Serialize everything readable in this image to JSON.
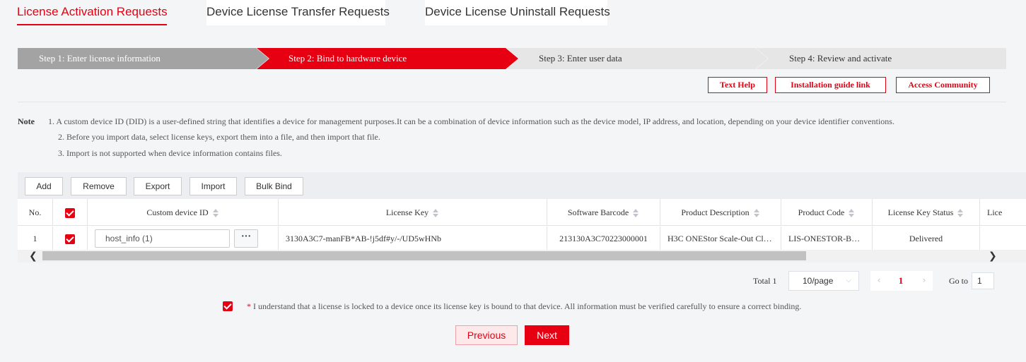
{
  "tabs": [
    {
      "label": "License Activation Requests"
    },
    {
      "label": "Device License Transfer Requests"
    },
    {
      "label": "Device License Uninstall Requests"
    }
  ],
  "steps": [
    {
      "label": "Step 1: Enter license information"
    },
    {
      "label": "Step 2: Bind to hardware device"
    },
    {
      "label": "Step 3: Enter user data"
    },
    {
      "label": "Step 4: Review and activate"
    }
  ],
  "help": {
    "text_help": "Text Help",
    "install_guide": "Installation guide link",
    "community": "Access Community"
  },
  "note": {
    "label": "Note",
    "lines": [
      "1. A custom device ID (DID) is a user-defined string that identifies a device for management purposes.It can be a combination of device information such as the device model, IP address, and location, depending on your device identifier conventions.",
      "2. Before you import data, select license keys, export them into a file, and then import that file.",
      "3. Import is not supported when device information contains files."
    ]
  },
  "toolbar": {
    "add": "Add",
    "remove": "Remove",
    "export": "Export",
    "import": "Import",
    "bulk_bind": "Bulk Bind"
  },
  "table": {
    "headers": {
      "no": "No.",
      "custom_device_id": "Custom device ID",
      "license_key": "License Key",
      "software_barcode": "Software Barcode",
      "product_description": "Product Description",
      "product_code": "Product Code",
      "license_key_status": "License Key Status",
      "more": "Lice"
    },
    "rows": [
      {
        "no": "1",
        "checked": true,
        "custom_device_id": "host_info (1)",
        "more_btn": "···",
        "license_key": "3130A3C7-manFB*AB-!j5df#y/-/UD5wHNb",
        "software_barcode": "213130A3C70223000001",
        "product_description": "H3C ONEStor Scale-Out Cl…",
        "product_code": "LIS-ONESTOR-B…",
        "license_key_status": "Delivered"
      }
    ]
  },
  "scroll": {
    "left": "❮",
    "right": "❯"
  },
  "pagination": {
    "total": "Total 1",
    "page_size": "10/page",
    "prev": "‹",
    "current": "1",
    "next": "›",
    "goto_label": "Go to",
    "goto_value": "1"
  },
  "agreement": {
    "star": "*",
    "text": " I understand that a license is locked to a device once its license key is bound to that device. All information must be verified carefully to ensure a correct binding."
  },
  "buttons": {
    "previous": "Previous",
    "next": "Next"
  },
  "colors": {
    "accent": "#e60012",
    "step_done": "#a3a3a3",
    "step_pending": "#e6e6e6"
  }
}
